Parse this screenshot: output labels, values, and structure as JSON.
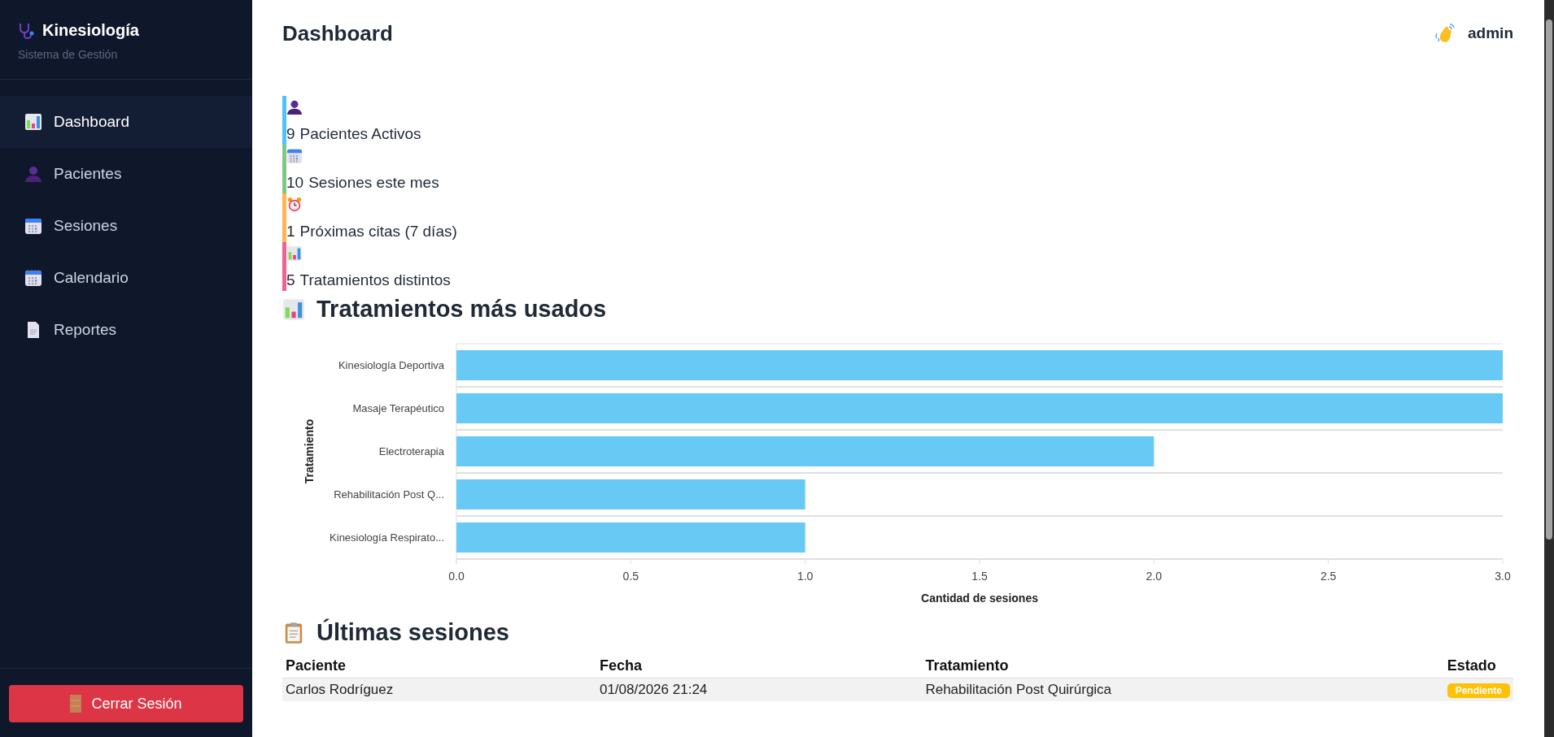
{
  "sidebar": {
    "brand": {
      "title": "Kinesiología",
      "subtitle": "Sistema de Gestión"
    },
    "items": [
      {
        "label": "Dashboard",
        "selected": true
      },
      {
        "label": "Pacientes",
        "selected": false
      },
      {
        "label": "Sesiones",
        "selected": false
      },
      {
        "label": "Calendario",
        "selected": false
      },
      {
        "label": "Reportes",
        "selected": false
      }
    ],
    "logout": "Cerrar Sesión"
  },
  "header": {
    "title": "Dashboard",
    "user": "admin"
  },
  "stats": [
    {
      "value": "9",
      "label": "Pacientes Activos",
      "color": "#4fc3f7"
    },
    {
      "value": "10",
      "label": "Sesiones este mes",
      "color": "#81c784"
    },
    {
      "value": "1",
      "label": "Próximas citas (7 días)",
      "color": "#ffb74d"
    },
    {
      "value": "5",
      "label": "Tratamientos distintos",
      "color": "#f06292"
    }
  ],
  "treatments_panel": {
    "title": "Tratamientos más usados",
    "chart_data": {
      "type": "bar",
      "orientation": "horizontal",
      "xlabel": "Cantidad de sesiones",
      "ylabel": "Tratamiento",
      "categories": [
        "Kinesiología Deportiva",
        "Masaje Terapéutico",
        "Electroterapia",
        "Rehabilitación Post Q...",
        "Kinesiología Respirato..."
      ],
      "series": [
        {
          "color": "#68c9f5",
          "values": [
            3,
            3,
            2,
            1,
            1
          ]
        }
      ],
      "xlim": [
        0,
        3
      ],
      "xticks": [
        {
          "value": 0,
          "label": "0.0"
        },
        {
          "value": 0.5,
          "label": "0.5"
        },
        {
          "value": 1,
          "label": "1.0"
        },
        {
          "value": 1.5,
          "label": "1.5"
        },
        {
          "value": 2,
          "label": "2.0"
        },
        {
          "value": 2.5,
          "label": "2.5"
        },
        {
          "value": 3,
          "label": "3.0"
        }
      ]
    }
  },
  "sessions_panel": {
    "title": "Últimas sesiones",
    "table": {
      "columns": [
        "Paciente",
        "Fecha",
        "Tratamiento",
        "Estado"
      ],
      "rows": [
        {
          "cells": [
            "Carlos Rodríguez",
            "01/08/2026 21:24",
            "Rehabilitación Post Quirúrgica"
          ],
          "status": "Pendiente"
        }
      ]
    }
  }
}
